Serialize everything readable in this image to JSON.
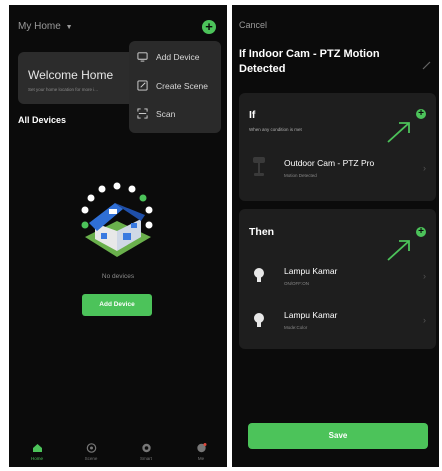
{
  "left": {
    "home_title": "My Home",
    "welcome": {
      "title": "Welcome Home",
      "subtitle": "Set your home location for more i..."
    },
    "menu": [
      {
        "label": "Add Device",
        "icon": "add-device-icon"
      },
      {
        "label": "Create Scene",
        "icon": "create-scene-icon"
      },
      {
        "label": "Scan",
        "icon": "scan-icon"
      }
    ],
    "all_devices": "All Devices",
    "no_devices": "No devices",
    "add_device_button": "Add Device",
    "tabs": [
      {
        "label": "Home",
        "icon": "home-icon",
        "active": true
      },
      {
        "label": "Scene",
        "icon": "scene-icon"
      },
      {
        "label": "Smart",
        "icon": "smart-icon"
      },
      {
        "label": "Me",
        "icon": "me-icon"
      }
    ]
  },
  "right": {
    "cancel": "Cancel",
    "title": "If Indoor Cam - PTZ Motion Detected",
    "if_section": {
      "heading": "If",
      "subtext": "When any condition is met",
      "condition": {
        "title": "Outdoor Cam - PTZ Pro",
        "subtitle": "Motion Detected"
      }
    },
    "then_section": {
      "heading": "Then",
      "actions": [
        {
          "title": "Lampu Kamar",
          "subtitle": "ON/OFF:ON"
        },
        {
          "title": "Lampu Kamar",
          "subtitle": "Mode:Color"
        }
      ]
    },
    "save_button": "Save"
  },
  "colors": {
    "accent": "#4cc35a",
    "background": "#0b0b0b",
    "card": "#1e1e1e"
  }
}
